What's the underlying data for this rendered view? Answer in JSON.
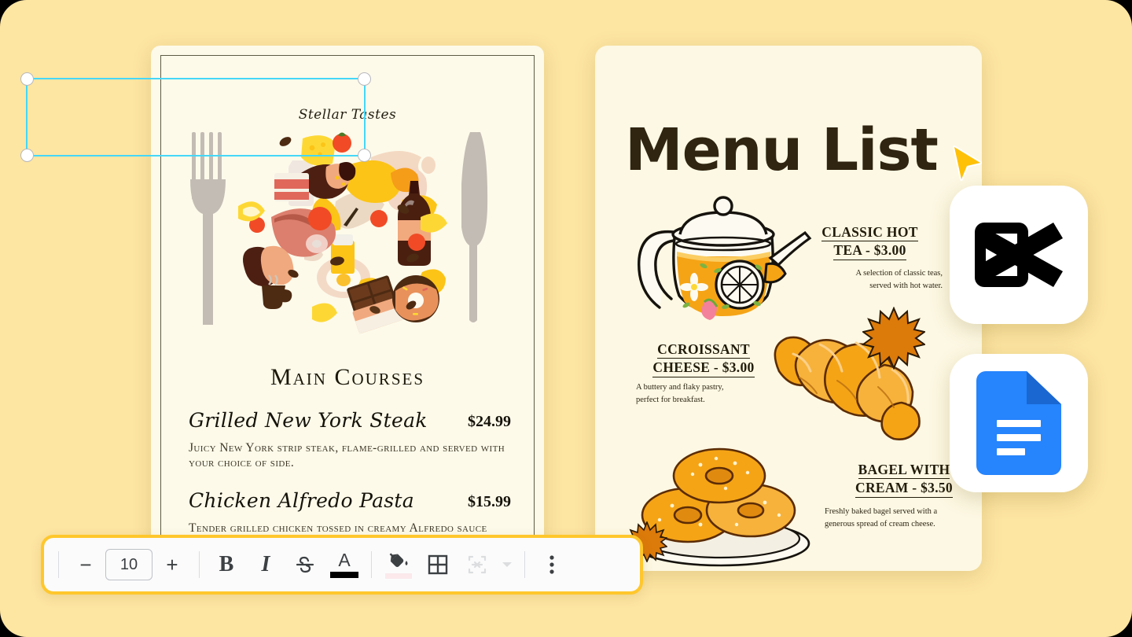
{
  "canvas": {
    "background_color": "#FDE5A2"
  },
  "document_card": {
    "brand": "Stellar Tastes",
    "section_title": "Main Courses",
    "items": [
      {
        "name": "Grilled New York  Steak",
        "price": "$24.99",
        "description": "Juicy New York strip steak, flame-grilled and served with your choice of side."
      },
      {
        "name": "Chicken Alfredo Pasta",
        "price": "$15.99",
        "description": "Tender grilled chicken tossed in creamy Alfredo sauce with fettuccine pasta"
      }
    ],
    "icons": {
      "fork": "fork-icon",
      "knife": "knife-icon",
      "illustration": "food-collage-illustration"
    }
  },
  "design_card": {
    "title": "Menu List",
    "selection": {
      "color": "#45D7F7",
      "handle_color": "#FFFFFF"
    },
    "cursor": {
      "name": "pointer-cursor",
      "color": "#FFC107"
    },
    "items": [
      {
        "heading_line1": "CLASSIC HOT",
        "heading_line2": "TEA - $3.00",
        "desc_line1": "A selection of classic teas,",
        "desc_line2": "served with hot water.",
        "illustration": "teapot-illustration"
      },
      {
        "heading_line1": "CCROISSANT",
        "heading_line2": "CHEESE - $3.00",
        "desc_line1": "A buttery and flaky pastry,",
        "desc_line2": "perfect for breakfast.",
        "illustration": "croissant-illustration"
      },
      {
        "heading_line1": "BAGEL WITH",
        "heading_line2": "CREAM - $3.50 ",
        "desc_line1": "Freshly baked bagel served with a",
        "desc_line2": "generous spread of cream cheese.",
        "illustration": "bagel-illustration"
      }
    ]
  },
  "app_icons": [
    {
      "name": "capcut-app-icon",
      "label": "CapCut",
      "color": "#000000"
    },
    {
      "name": "google-docs-app-icon",
      "label": "Google Docs",
      "color": "#2684FC"
    }
  ],
  "toolbar": {
    "accent_color": "#FFC72C",
    "decrease_font_label": "−",
    "font_size_value": "10",
    "increase_font_label": "+",
    "bold_label": "B",
    "italic_label": "I",
    "strikethrough_name": "strikethrough-icon",
    "text_color_label": "A",
    "text_color_swatch": "#000000",
    "fill_color_name": "fill-color-icon",
    "fill_color_swatch": "#FBE9EC",
    "borders_name": "table-borders-icon",
    "merge_cells_name": "merge-cells-icon",
    "merge_dropdown_name": "chevron-down-icon",
    "more_options_name": "more-vertical-icon"
  }
}
